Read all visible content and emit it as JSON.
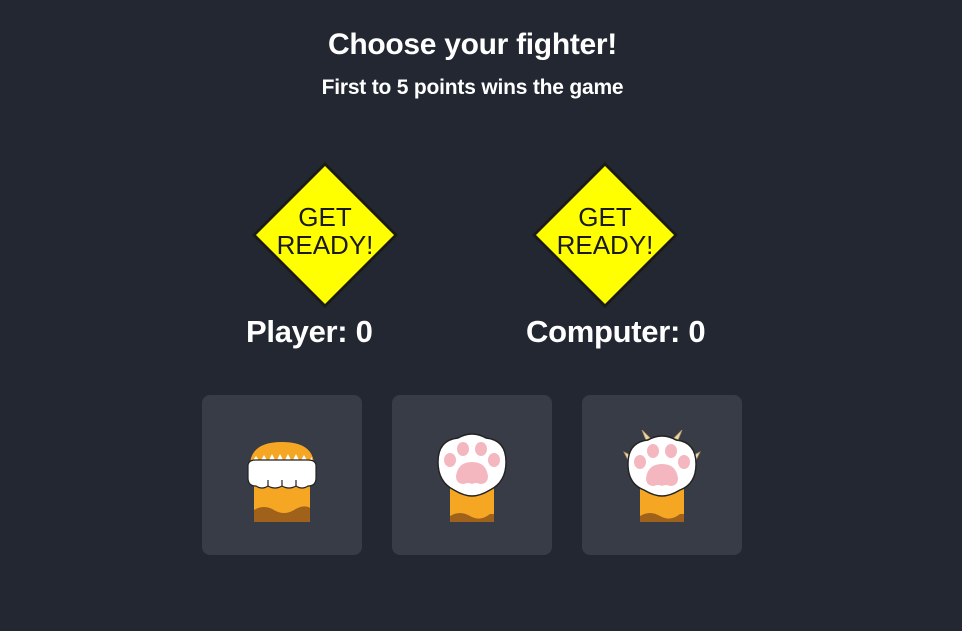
{
  "header": {
    "title": "Choose your fighter!",
    "subtitle": "First to 5 points wins the game"
  },
  "signs": {
    "line1": "GET",
    "line2": "READY!",
    "color": "#ffff00"
  },
  "scores": {
    "player_label": "Player: 0",
    "computer_label": "Computer: 0"
  },
  "choices": [
    {
      "name": "rock",
      "icon": "fist-paw-icon"
    },
    {
      "name": "paper",
      "icon": "open-paw-icon"
    },
    {
      "name": "scissors",
      "icon": "claw-paw-icon"
    }
  ],
  "colors": {
    "background": "#222731",
    "card": "#383c47",
    "fur": "#f5a623",
    "paw_pad": "#f4b7c0"
  }
}
